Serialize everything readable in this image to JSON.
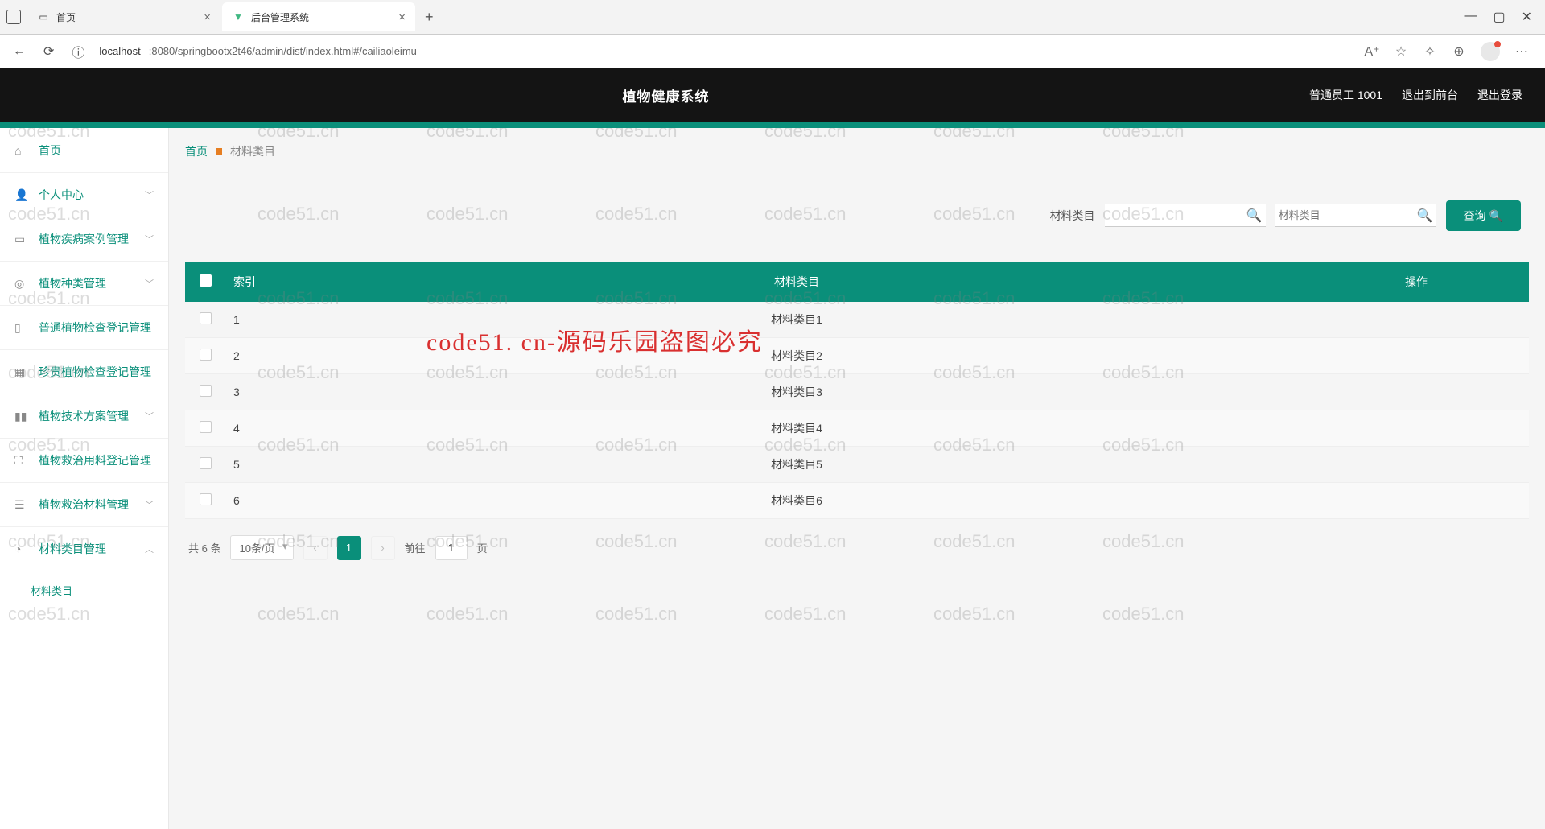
{
  "browser": {
    "tabs": [
      {
        "title": "首页"
      },
      {
        "title": "后台管理系统"
      }
    ],
    "url_host": "localhost",
    "url_path": ":8080/springbootx2t46/admin/dist/index.html#/cailiaoleimu"
  },
  "header": {
    "app_title": "植物健康系统",
    "user_role": "普通员工 1001",
    "link_front": "退出到前台",
    "link_logout": "退出登录"
  },
  "sidebar": {
    "items": [
      {
        "label": "首页",
        "icon": "home"
      },
      {
        "label": "个人中心",
        "icon": "user",
        "expandable": true
      },
      {
        "label": "植物疾病案例管理",
        "icon": "chat",
        "expandable": true
      },
      {
        "label": "植物种类管理",
        "icon": "target",
        "expandable": true
      },
      {
        "label": "普通植物检查登记管理",
        "icon": "file"
      },
      {
        "label": "珍贵植物检查登记管理",
        "icon": "dash"
      },
      {
        "label": "植物技术方案管理",
        "icon": "bars",
        "expandable": true
      },
      {
        "label": "植物救治用料登记管理",
        "icon": "scan"
      },
      {
        "label": "植物救治材料管理",
        "icon": "layers",
        "expandable": true
      },
      {
        "label": "材料类目管理",
        "icon": "clock",
        "expandable": true,
        "open": true
      }
    ],
    "submenu": "材料类目"
  },
  "breadcrumb": {
    "home": "首页",
    "current": "材料类目"
  },
  "search": {
    "label1": "材料类目",
    "placeholder1": "",
    "placeholder2": "材料类目",
    "query_btn": "查询"
  },
  "table": {
    "columns": [
      "索引",
      "材料类目",
      "操作"
    ],
    "rows": [
      {
        "index": "1",
        "name": "材料类目1"
      },
      {
        "index": "2",
        "name": "材料类目2"
      },
      {
        "index": "3",
        "name": "材料类目3"
      },
      {
        "index": "4",
        "name": "材料类目4"
      },
      {
        "index": "5",
        "name": "材料类目5"
      },
      {
        "index": "6",
        "name": "材料类目6"
      }
    ]
  },
  "pagination": {
    "total": "共 6 条",
    "page_size": "10条/页",
    "current": "1",
    "goto_label": "前往",
    "goto_value": "1",
    "goto_suffix": "页"
  },
  "watermark_text": "code51.cn",
  "watermark_red": "code51. cn-源码乐园盗图必究"
}
